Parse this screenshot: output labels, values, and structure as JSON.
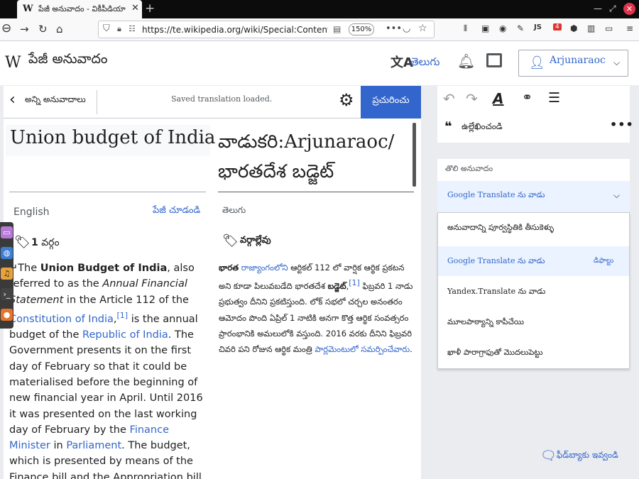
{
  "browser": {
    "tab_title": "పేజీ అనువాదం - వికీపీడియా",
    "tab_favicon": "W",
    "tab_close": "✕",
    "new_tab": "+",
    "url": "https://te.wikipedia.org/wiki/Special:ContentTra",
    "zoom": "150%",
    "toolbar_text_js": "JS",
    "badge_count": "4"
  },
  "wiki": {
    "logo": "W",
    "page_title": "పేజీ అనువాదం",
    "language_icon": "文A",
    "language_label": "తెలుగు",
    "username": "Arjunaraoc"
  },
  "editor": {
    "back_label": "అన్ని అనువాదాలు",
    "status": "Saved translation loaded.",
    "publish_label": "ప్రచురించు",
    "source": {
      "title": "Union budget of India",
      "language": "English",
      "view_page": "పేజీ చూడండి",
      "category_count": "1",
      "category_label": "వర్గం",
      "para": {
        "arrow": "↵",
        "t1": "The ",
        "bold": "Union Budget of India",
        "t2": ", also referred to as the ",
        "italic": "Annual Financial Statement",
        "t3": " in the Article 112 of the ",
        "link1": "Constitution of India",
        "t4": ",",
        "ref": "[1]",
        "t5": " is the annual budget of the ",
        "link2": "Republic of India",
        "t6": ". The Government presents it on the first day of February so that it could be materialised before the beginning of new financial year in April. Until 2016 it was presented on the last working day of February by the ",
        "link3": "Finance Minister",
        "t7": " in ",
        "link4": "Parliament",
        "t8": ". The budget, which is presented by means of the Finance bill and the Appropriation bill has to be"
      }
    },
    "target": {
      "title": "వాడుకరి:Arjunaraoc/భారతదేశ బడ్జెట్",
      "language": "తెలుగు",
      "category_label": "వర్గాల్లేవు",
      "para": {
        "b1": "భారత",
        "l1": "రాజ్యాంగంలోని",
        "t1": " ఆర్టికల్ 112 లో వార్షిక ఆర్థిక ప్రకటన అని కూడా పిలువబడేది భారతదేశ ",
        "b2": "బడ్జెట్",
        "t2": ",",
        "ref": "[1]",
        "t3": " ఫిబ్రవరి 1 నాడు ప్రభుత్వం దీనిని ప్రకటిస్తుంది. లోక్ సభలో చర్చల అనంతరం ఆమోదం పొంది ఏప్రిల్ 1 నాటికి అనగా కొత్త ఆర్థిక సంవత్సరం ప్రారంభానికి అమలులోకి వస్తుంది. 2016 వరకు దీనిని ఫిబ్రవరి చివరి పని రోజున ఆర్థిక మంత్రి ",
        "l2": "పార్లమెంటులో సమర్పించేవారు",
        "t4": "."
      }
    }
  },
  "sidebar": {
    "quote_label": "ఉల్లేఖించండి",
    "mt_heading": "తొలి అనువాదం",
    "mt_selected": "Google Translate ను వాడు",
    "mt_options": [
      {
        "label": "అనువాదాన్ని పూర్వస్థితికి తీసుకెళ్ళు"
      },
      {
        "label": "Google Translate ను వాడు",
        "badge": "డిఫాల్టు"
      },
      {
        "label": "Yandex.Translate ను వాడు"
      },
      {
        "label": "మూలపాఠ్యాన్ని కాపీచేయి"
      },
      {
        "label": "ఖాళీ పారాగ్రాఫుతో మొదలుపెట్టు"
      }
    ],
    "feedback_label": "ఫీడ్‌బ్యాకు ఇవ్వండి"
  },
  "colors": {
    "accent": "#3366cc",
    "selected_bg": "#eaf3ff",
    "page_bg": "#eaecf0"
  }
}
